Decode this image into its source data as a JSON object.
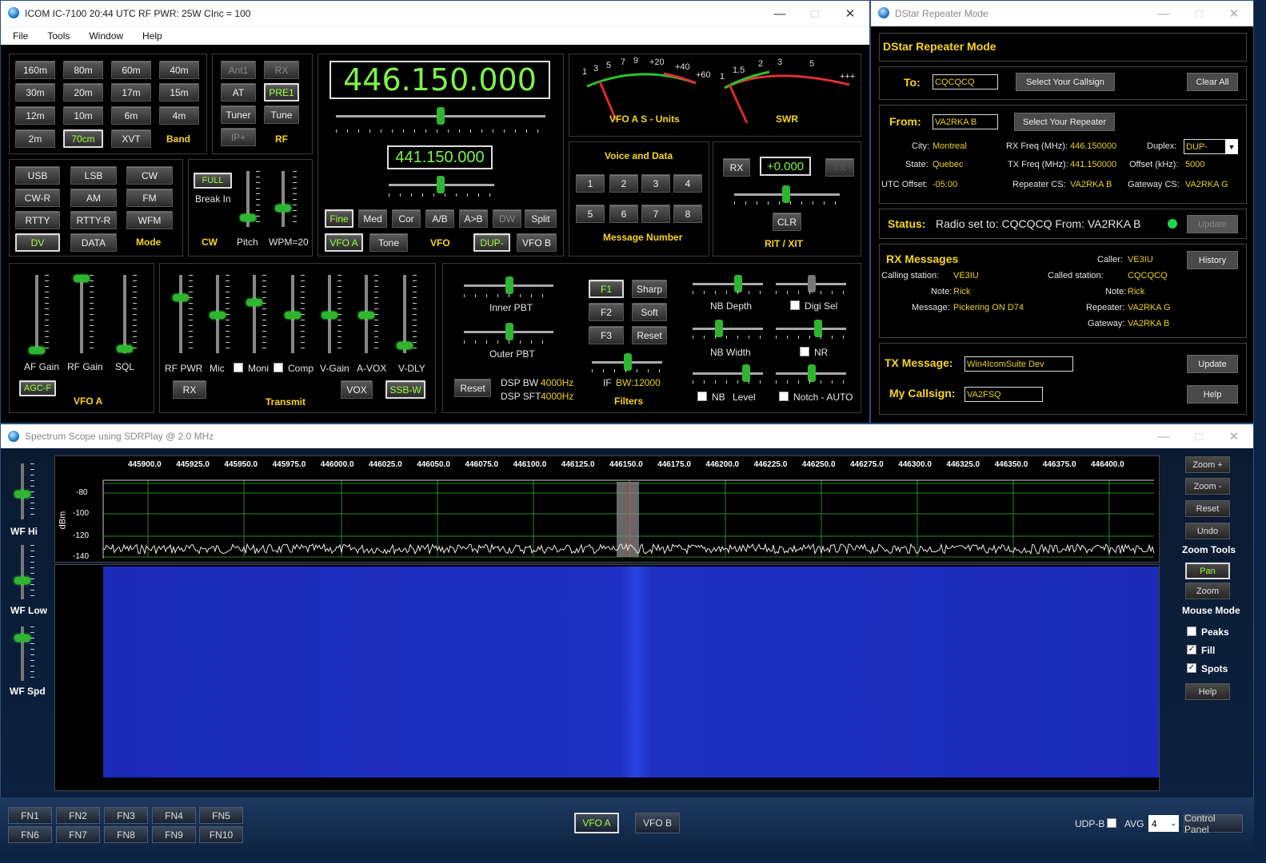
{
  "main_window": {
    "title": "ICOM IC-7100  20:44 UTC  RF PWR: 25W  CInc = 100",
    "menu": [
      "File",
      "Tools",
      "Window",
      "Help"
    ],
    "band": {
      "buttons": [
        "160m",
        "80m",
        "60m",
        "40m",
        "30m",
        "20m",
        "17m",
        "15m",
        "12m",
        "10m",
        "6m",
        "4m",
        "2m",
        "70cm",
        "XVT"
      ],
      "label": "Band",
      "active": "70cm"
    },
    "rf": {
      "buttons": [
        "Ant1",
        "RX",
        "AT",
        "PRE1",
        "Tuner",
        "Tune",
        "IP+"
      ],
      "label": "RF"
    },
    "mode": {
      "buttons": [
        "USB",
        "LSB",
        "CW",
        "CW-R",
        "AM",
        "FM",
        "RTTY",
        "RTTY-R",
        "WFM",
        "DV",
        "DATA"
      ],
      "label": "Mode",
      "active": "DV"
    },
    "cw": {
      "full": "FULL",
      "break_in": "Break In",
      "label": "CW",
      "pitch": "Pitch",
      "wpm": "WPM=20"
    },
    "vfo": {
      "main_freq": "446.150.000",
      "sub_freq": "441.150.000",
      "buttons": [
        "Fine",
        "Med",
        "Cor",
        "A/B",
        "A>B",
        "DW",
        "Split"
      ],
      "vfoa": "VFO A",
      "tone": "Tone",
      "label": "VFO",
      "dup": "DUP-",
      "vfob": "VFO B"
    },
    "meters": {
      "s_label": "VFO A S - Units",
      "swr_label": "SWR",
      "s_scale": [
        "1",
        "3",
        "5",
        "7",
        "9",
        "+20",
        "+40",
        "+60"
      ],
      "swr_scale": [
        "1",
        "1.5",
        "2",
        "3",
        "5",
        "+++"
      ]
    },
    "voice": {
      "title": "Voice and Data",
      "buttons": [
        "1",
        "2",
        "3",
        "4",
        "5",
        "6",
        "7",
        "8"
      ],
      "label": "Message Number"
    },
    "rit": {
      "rx": "RX",
      "value": "+0.000",
      "tx": "TX",
      "clr": "CLR",
      "label": "RIT / XIT"
    },
    "vfoa_panel": {
      "labels": [
        "AF Gain",
        "RF Gain",
        "SQL"
      ],
      "agc": "AGC-F",
      "label": "VFO A"
    },
    "transmit": {
      "labels": [
        "RF PWR",
        "Mic",
        "Moni",
        "Comp",
        "V-Gain",
        "A-VOX",
        "V-DLY"
      ],
      "rx": "RX",
      "vox": "VOX",
      "ssb": "SSB-W",
      "label": "Transmit"
    },
    "filters": {
      "inner": "Inner PBT",
      "outer": "Outer PBT",
      "reset": "Reset",
      "dsp_bw": "DSP BW",
      "dsp_bw_v": "4000Hz",
      "dsp_sft": "DSP SFT",
      "dsp_sft_v": "4000Hz",
      "f1": "F1",
      "f2": "F2",
      "f3": "F3",
      "sharp": "Sharp",
      "soft": "Soft",
      "reset2": "Reset",
      "if": "IF",
      "if_bw": "BW:12000",
      "label": "Filters",
      "nb_depth": "NB Depth",
      "digi_sel": "Digi Sel",
      "nb_width": "NB Width",
      "nr": "NR",
      "nb": "NB",
      "level": "Level",
      "notch": "Notch - AUTO"
    }
  },
  "dstar": {
    "title": "DStar Repeater Mode",
    "heading": "DStar Repeater Mode",
    "to_label": "To:",
    "to_value": "CQCQCQ",
    "select_callsign": "Select Your Callsign",
    "clear_all": "Clear All",
    "from_label": "From:",
    "from_value": "VA2RKA B",
    "select_repeater": "Select Your Repeater",
    "city_l": "City:",
    "city": "Montreal",
    "rxf_l": "RX Freq (MHz):",
    "rxf": "446.150000",
    "duplex_l": "Duplex:",
    "duplex": "DUP-",
    "state_l": "State:",
    "state": "Quebec",
    "txf_l": "TX Freq (MHz):",
    "txf": "441.150000",
    "offset_l": "Offset (kHz):",
    "offset": "5000",
    "utc_l": "UTC Offset:",
    "utc": "-05:00",
    "rcs_l": "Repeater CS:",
    "rcs": "VA2RKA B",
    "gcs_l": "Gateway CS:",
    "gcs": "VA2RKA G",
    "status_l": "Status:",
    "status": "Radio set to:  CQCQCQ   From:  VA2RKA B",
    "update": "Update",
    "rx_title": "RX Messages",
    "caller_l": "Caller:",
    "caller": "VE3IU",
    "history": "History",
    "calling_l": "Calling station:",
    "calling": "VE3IU",
    "called_l": "Called station:",
    "called": "CQCQCQ",
    "note_l": "Note:",
    "note1": "Rick",
    "note2": "Rick",
    "msg_l": "Message:",
    "msg": "Pickering ON D74",
    "rep_l": "Repeater:",
    "rep": "VA2RKA G",
    "gw_l": "Gateway:",
    "gw": "VA2RKA B",
    "txmsg_l": "TX Message:",
    "txmsg": "Win4IcomSuite Dev",
    "update2": "Update",
    "mycall_l": "My Callsign:",
    "mycall": "VA2FSQ",
    "help": "Help"
  },
  "spectrum": {
    "title": "Spectrum Scope using SDRPlay @ 2.0 MHz",
    "freqs": [
      "445900.0",
      "445925.0",
      "445950.0",
      "445975.0",
      "446000.0",
      "446025.0",
      "446050.0",
      "446075.0",
      "446100.0",
      "446125.0",
      "446150.0",
      "446175.0",
      "446200.0",
      "446225.0",
      "446250.0",
      "446275.0",
      "446300.0",
      "446325.0",
      "446350.0",
      "446375.0",
      "446400.0"
    ],
    "dbm": [
      "-80",
      "-100",
      "-120",
      "-140"
    ],
    "ylabel": "dBm",
    "left": [
      "WF Hi",
      "WF Low",
      "WF Spd"
    ],
    "tools": {
      "zoom_plus": "Zoom +",
      "zoom_minus": "Zoom -",
      "reset": "Reset",
      "undo": "Undo",
      "zoom_tools": "Zoom Tools",
      "pan": "Pan",
      "zoom": "Zoom",
      "mouse_mode": "Mouse Mode",
      "peaks": "Peaks",
      "fill": "Fill",
      "spots": "Spots",
      "help": "Help"
    },
    "fn": [
      "FN1",
      "FN2",
      "FN3",
      "FN4",
      "FN5",
      "FN6",
      "FN7",
      "FN8",
      "FN9",
      "FN10"
    ],
    "vfoa": "VFO A",
    "vfob": "VFO B",
    "udpb": "UDP-B",
    "avg": "AVG",
    "avg_val": "4",
    "control": "Control Panel"
  }
}
